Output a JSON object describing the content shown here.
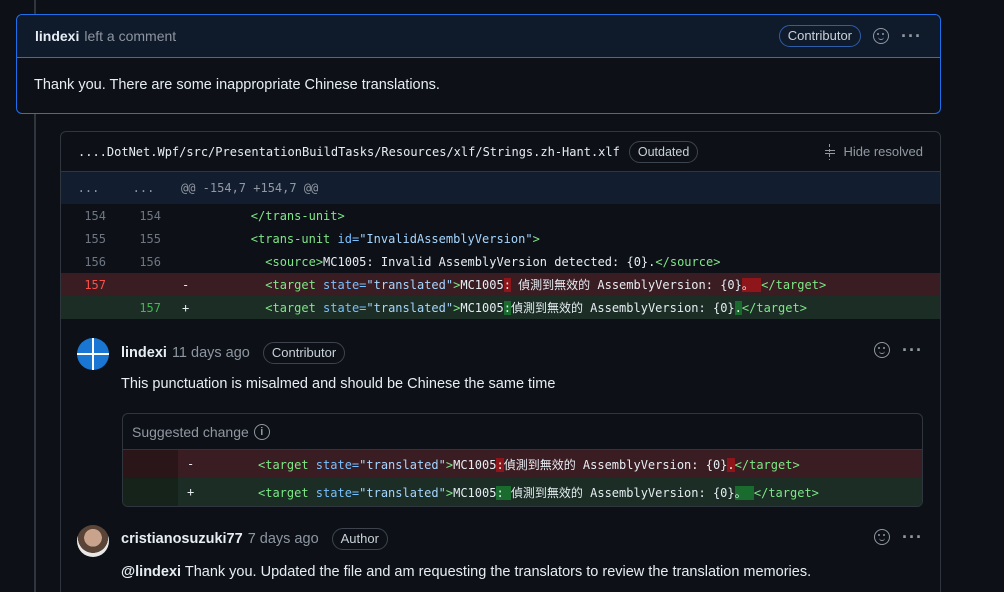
{
  "review": {
    "author": "lindexi",
    "action": "left a comment",
    "badge": "Contributor",
    "body": "Thank you. There are some inappropriate Chinese translations."
  },
  "file": {
    "path": "....DotNet.Wpf/src/PresentationBuildTasks/Resources/xlf/Strings.zh-Hant.xlf",
    "badge": "Outdated",
    "hide_resolved": "Hide resolved"
  },
  "diff": {
    "hunk": {
      "left": "...",
      "right": "...",
      "text": "@@ -154,7 +154,7 @@"
    },
    "rows": [
      {
        "left": "154",
        "right": "154",
        "sign": "",
        "indent": "        ",
        "open": "</trans-unit>",
        "attrs": "",
        "content": "",
        "close": ""
      },
      {
        "left": "155",
        "right": "155",
        "sign": "",
        "indent": "        ",
        "open": "<trans-unit",
        "attrs": " id=",
        "value": "\"InvalidAssemblyVersion\"",
        "open_end": ">",
        "content": "",
        "close": ""
      },
      {
        "left": "156",
        "right": "156",
        "sign": "",
        "indent": "          ",
        "open": "<source>",
        "content": "MC1005: Invalid AssemblyVersion detected: {0}.",
        "close": "</source>"
      },
      {
        "left": "157",
        "right": "",
        "sign": "-",
        "indent": "          ",
        "open": "<target",
        "attrs": " state=",
        "value": "\"translated\"",
        "open_end": ">",
        "content_a": "MC1005",
        "hl1": ":",
        "content_b": " 偵測到無效的 AssemblyVersion: {0}",
        "hl2": "。",
        "content_c": " ",
        "close": "</target>"
      },
      {
        "left": "",
        "right": "157",
        "sign": "+",
        "indent": "          ",
        "open": "<target",
        "attrs": " state=",
        "value": "\"translated\"",
        "open_end": ">",
        "content_a": "MC1005",
        "hl1": ":",
        "content_b": "偵測到無效的 AssemblyVersion: {0}",
        "hl2": ".",
        "content_c": "",
        "close": "</target>"
      }
    ]
  },
  "comments": [
    {
      "author": "lindexi",
      "time": "11 days ago",
      "badge": "Contributor",
      "body": "This punctuation is misalmed and should be Chinese the same time"
    },
    {
      "author": "cristianosuzuki77",
      "time": "7 days ago",
      "badge": "Author",
      "mention": "@lindexi",
      "body": " Thank you. Updated the file and am requesting the translators to review the translation memories."
    }
  ],
  "suggestion": {
    "title": "Suggested change",
    "info": "i",
    "rows": [
      {
        "sign": "-",
        "indent": "  ",
        "open": "<target",
        "attrs": " state=",
        "value": "\"translated\"",
        "open_end": ">",
        "content_a": "MC1005",
        "hl1": ":",
        "content_b": "偵測到無效的 AssemblyVersion: {0}",
        "hl2": ".",
        "content_c": "",
        "close": "</target>"
      },
      {
        "sign": "+",
        "indent": "  ",
        "open": "<target",
        "attrs": " state=",
        "value": "\"translated\"",
        "open_end": ">",
        "content_a": "MC1005",
        "hl1": ": ",
        "content_b": "偵測到無效的 AssemblyVersion: {0}",
        "hl2": "。",
        "content_c": " ",
        "close": "</target>"
      }
    ]
  },
  "icons": {
    "reaction": "smiley-icon",
    "more": "kebab-horizontal-icon",
    "unfold": "unfold-icon",
    "info": "info-icon"
  },
  "colors": {
    "accent": "#1f6feb",
    "deletion": "#3a1d22",
    "addition": "#1b2d24"
  }
}
